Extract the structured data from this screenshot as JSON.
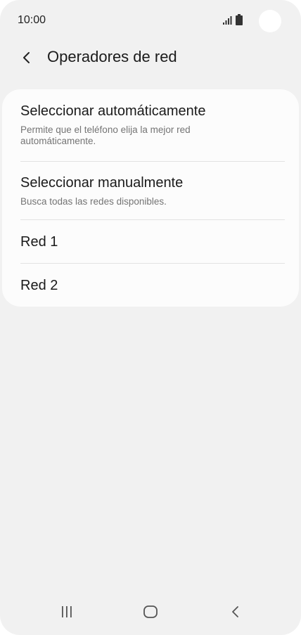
{
  "status_bar": {
    "time": "10:00",
    "icons": [
      "signal-icon",
      "battery-icon"
    ]
  },
  "header": {
    "back_icon": "chevron-left-icon",
    "title": "Operadores de red"
  },
  "options": [
    {
      "title": "Seleccionar automáticamente",
      "subtitle": "Permite que el teléfono elija la mejor red automáticamente."
    },
    {
      "title": "Seleccionar manualmente",
      "subtitle": "Busca todas las redes disponibles."
    },
    {
      "title": "Red 1"
    },
    {
      "title": "Red 2"
    }
  ],
  "nav_bar": {
    "icons": [
      "recent-apps-icon",
      "home-icon",
      "back-icon"
    ]
  },
  "colors": {
    "background": "#f1f1f1",
    "card": "#fcfcfc",
    "text_primary": "#1a1a1a",
    "text_secondary": "#747474",
    "divider": "#e2e2e2"
  }
}
